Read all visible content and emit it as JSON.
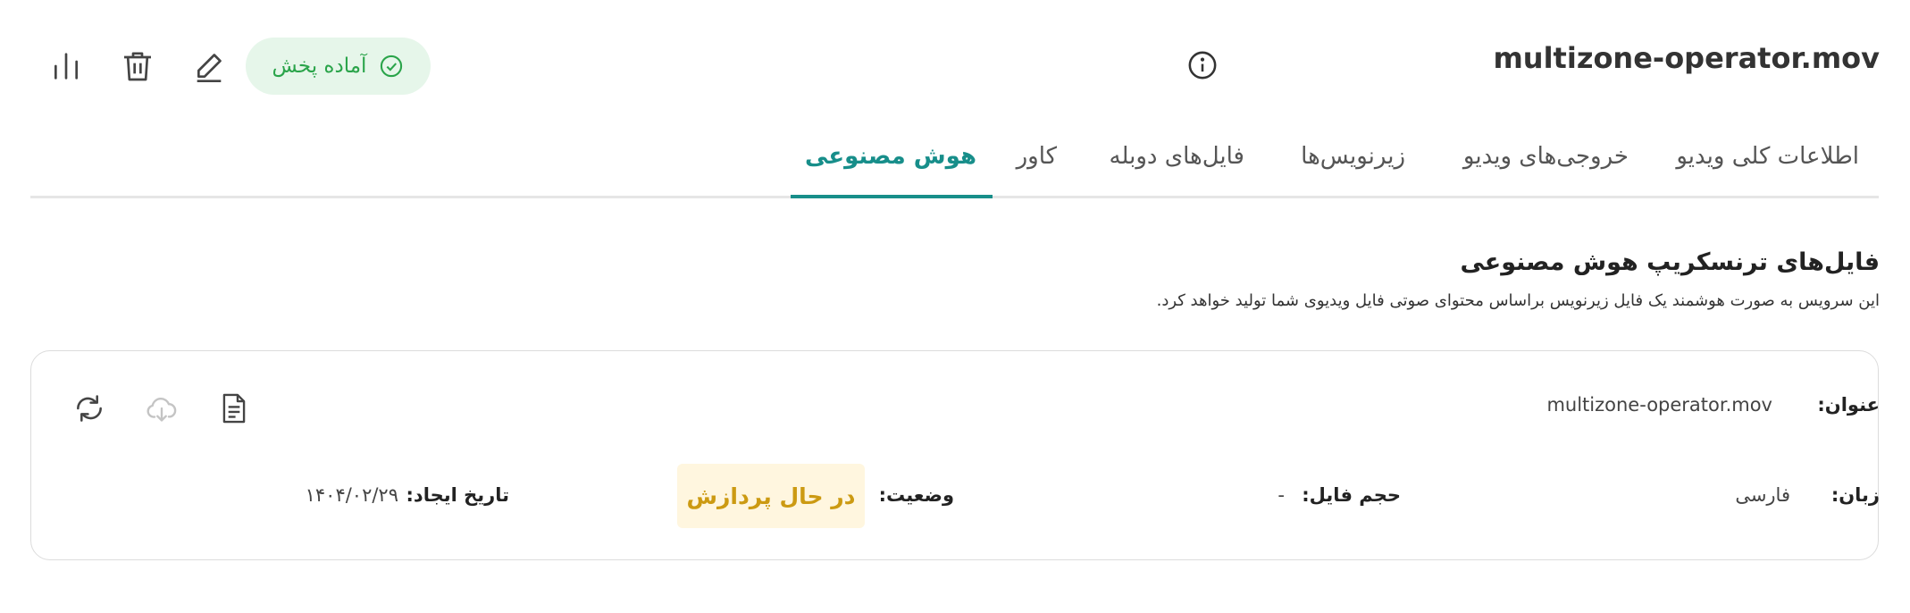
{
  "header": {
    "file_name": "multizone-operator.mov",
    "status_label": "آماده پخش",
    "icons": [
      "info-icon",
      "check-circle-icon",
      "pencil-icon",
      "trash-icon",
      "bar-chart-icon"
    ]
  },
  "tabs": [
    {
      "label": "اطلاعات کلی ویدیو",
      "active": false
    },
    {
      "label": "خروجی‌های ویدیو",
      "active": false
    },
    {
      "label": "زیرنویس‌ها",
      "active": false
    },
    {
      "label": "فایل‌های دوبله",
      "active": false
    },
    {
      "label": "کاور",
      "active": false
    },
    {
      "label": "هوش مصنوعی",
      "active": true
    }
  ],
  "section": {
    "title": "فایل‌های ترنسکریپ هوش مصنوعی",
    "description": "این سرویس به صورت هوشمند یک فایل زیرنویس براساس محتوای صوتی فایل ویدیوی شما تولید خواهد کرد."
  },
  "card": {
    "title_label": "عنوان:",
    "title_value": "multizone-operator.mov",
    "language_label": "زبان:",
    "language_value": "فارسی",
    "size_label": "حجم فایل:",
    "size_value": "-",
    "status_label": "وضعیت:",
    "status_value": "در حال پردازش",
    "created_label": "تاریخ ایجاد:",
    "created_value": "۱۴۰۴/۰۲/۲۹",
    "icons": [
      "document-icon",
      "cloud-download-icon",
      "refresh-icon"
    ]
  },
  "colors": {
    "accent": "#178e8a",
    "ready_bg": "#e6f6ea",
    "ready_text": "#2aa44a",
    "processing_bg": "#fff6df",
    "processing_text": "#cc9a12"
  }
}
